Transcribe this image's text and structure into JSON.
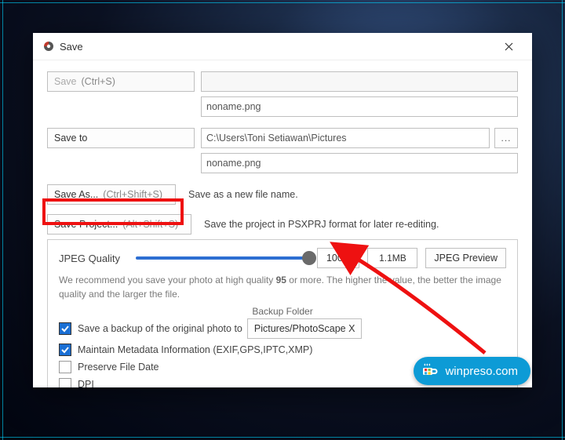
{
  "window": {
    "title": "Save"
  },
  "save_section": {
    "save_btn": {
      "label": "Save",
      "shortcut": "(Ctrl+S)"
    },
    "filename_top": "noname.png",
    "save_to_btn": "Save to",
    "save_to_path": "C:\\Users\\Toni Setiawan\\Pictures",
    "filename_bottom": "noname.png",
    "browse_btn": "...",
    "save_as_btn": {
      "label": "Save As...",
      "shortcut": "(Ctrl+Shift+S)"
    },
    "save_as_desc": "Save as a new file name.",
    "save_project_btn": {
      "label": "Save Project...",
      "shortcut": "(Alt+Shift+S)"
    },
    "save_project_desc": "Save the project in PSXPRJ format for later re-editing."
  },
  "jpeg": {
    "label": "JPEG Quality",
    "value": "100",
    "size": "1.1MB",
    "preview_btn": "JPEG Preview",
    "slider_percent": 100,
    "help_pre": "We recommend you save your photo at high quality ",
    "help_bold": "95",
    "help_post": " or more. The higher the value, the better the image quality and the larger the file."
  },
  "options": {
    "backup_header": "Backup Folder",
    "backup_label": "Save a backup of the original photo to",
    "backup_folder": "Pictures/PhotoScape X",
    "metadata_label": "Maintain Metadata Information (EXIF,GPS,IPTC,XMP)",
    "preserve_date_label": "Preserve File Date",
    "dpi_label": "DPI"
  },
  "watermark": "winpreso.com"
}
